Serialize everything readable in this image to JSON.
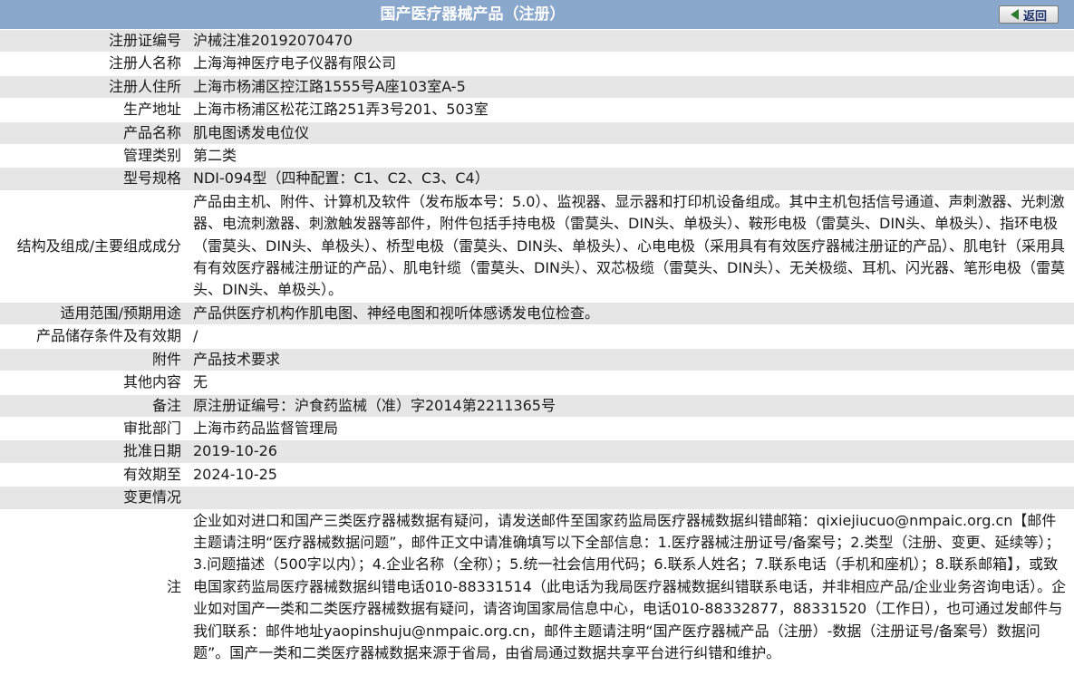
{
  "header": {
    "title": "国产医疗器械产品（注册）",
    "back_label": "返回"
  },
  "rows": [
    {
      "label": "注册证编号",
      "value": "沪械注准20192070470"
    },
    {
      "label": "注册人名称",
      "value": "上海海神医疗电子仪器有限公司"
    },
    {
      "label": "注册人住所",
      "value": "上海市杨浦区控江路1555号A座103室A-5"
    },
    {
      "label": "生产地址",
      "value": "上海市杨浦区松花江路251弄3号201、503室"
    },
    {
      "label": "产品名称",
      "value": "肌电图诱发电位仪"
    },
    {
      "label": "管理类别",
      "value": "第二类"
    },
    {
      "label": "型号规格",
      "value": "NDI-094型（四种配置：C1、C2、C3、C4）"
    },
    {
      "label": "结构及组成/主要组成成分",
      "value": "产品由主机、附件、计算机及软件（发布版本号：5.0）、监视器、显示器和打印机设备组成。其中主机包括信号通道、声刺激器、光刺激器、电流刺激器、刺激触发器等部件，附件包括手持电极（雷莫头、DIN头、单极头）、鞍形电极（雷莫头、DIN头、单极头）、指环电极（雷莫头、DIN头、单极头）、桥型电极（雷莫头、DIN头、单极头）、心电电极（采用具有有效医疗器械注册证的产品）、肌电针（采用具有有效医疗器械注册证的产品）、肌电针缆（雷莫头、DIN头）、双芯极缆（雷莫头、DIN头）、无关极缆、耳机、闪光器、笔形电极（雷莫头、DIN头、单极头）。"
    },
    {
      "label": "适用范围/预期用途",
      "value": "产品供医疗机构作肌电图、神经电图和视听体感诱发电位检查。"
    },
    {
      "label": "产品储存条件及有效期",
      "value": "/"
    },
    {
      "label": "附件",
      "value": "产品技术要求"
    },
    {
      "label": "其他内容",
      "value": "无"
    },
    {
      "label": "备注",
      "value": "原注册证编号：沪食药监械（准）字2014第2211365号"
    },
    {
      "label": "审批部门",
      "value": "上海市药品监督管理局"
    },
    {
      "label": "批准日期",
      "value": "2019-10-26"
    },
    {
      "label": "有效期至",
      "value": "2024-10-25"
    }
  ],
  "changes": {
    "label": "变更情况",
    "value": ""
  },
  "note": {
    "label": "注",
    "value": "企业如对进口和国产三类医疗器械数据有疑问，请发送邮件至国家药监局医疗器械数据纠错邮箱：qixiejiucuo@nmpaic.org.cn【邮件主题请注明“医疗器械数据问题”，邮件正文中请准确填写以下全部信息：1.医疗器械注册证号/备案号；2.类型（注册、变更、延续等）；3.问题描述（500字以内）；4.企业名称（全称）；5.统一社会信用代码；6.联系人姓名；7.联系电话（手机和座机）；8.联系邮箱】，或致电国家药监局医疗器械数据纠错电话010-88331514（此电话为我局医疗器械数据纠错联系电话，并非相应产品/企业业务咨询电话）。企业如对国产一类和二类医疗器械数据有疑问，请咨询国家局信息中心，电话010-88332877，88331520（工作日），也可通过发邮件与我们联系：邮件地址yaopinshuju@nmpaic.org.cn，邮件主题请注明“国产医疗器械产品（注册）-数据（注册证号/备案号）数据问题”。国产一类和二类医疗器械数据来源于省局，由省局通过数据共享平台进行纠错和维护。"
  }
}
